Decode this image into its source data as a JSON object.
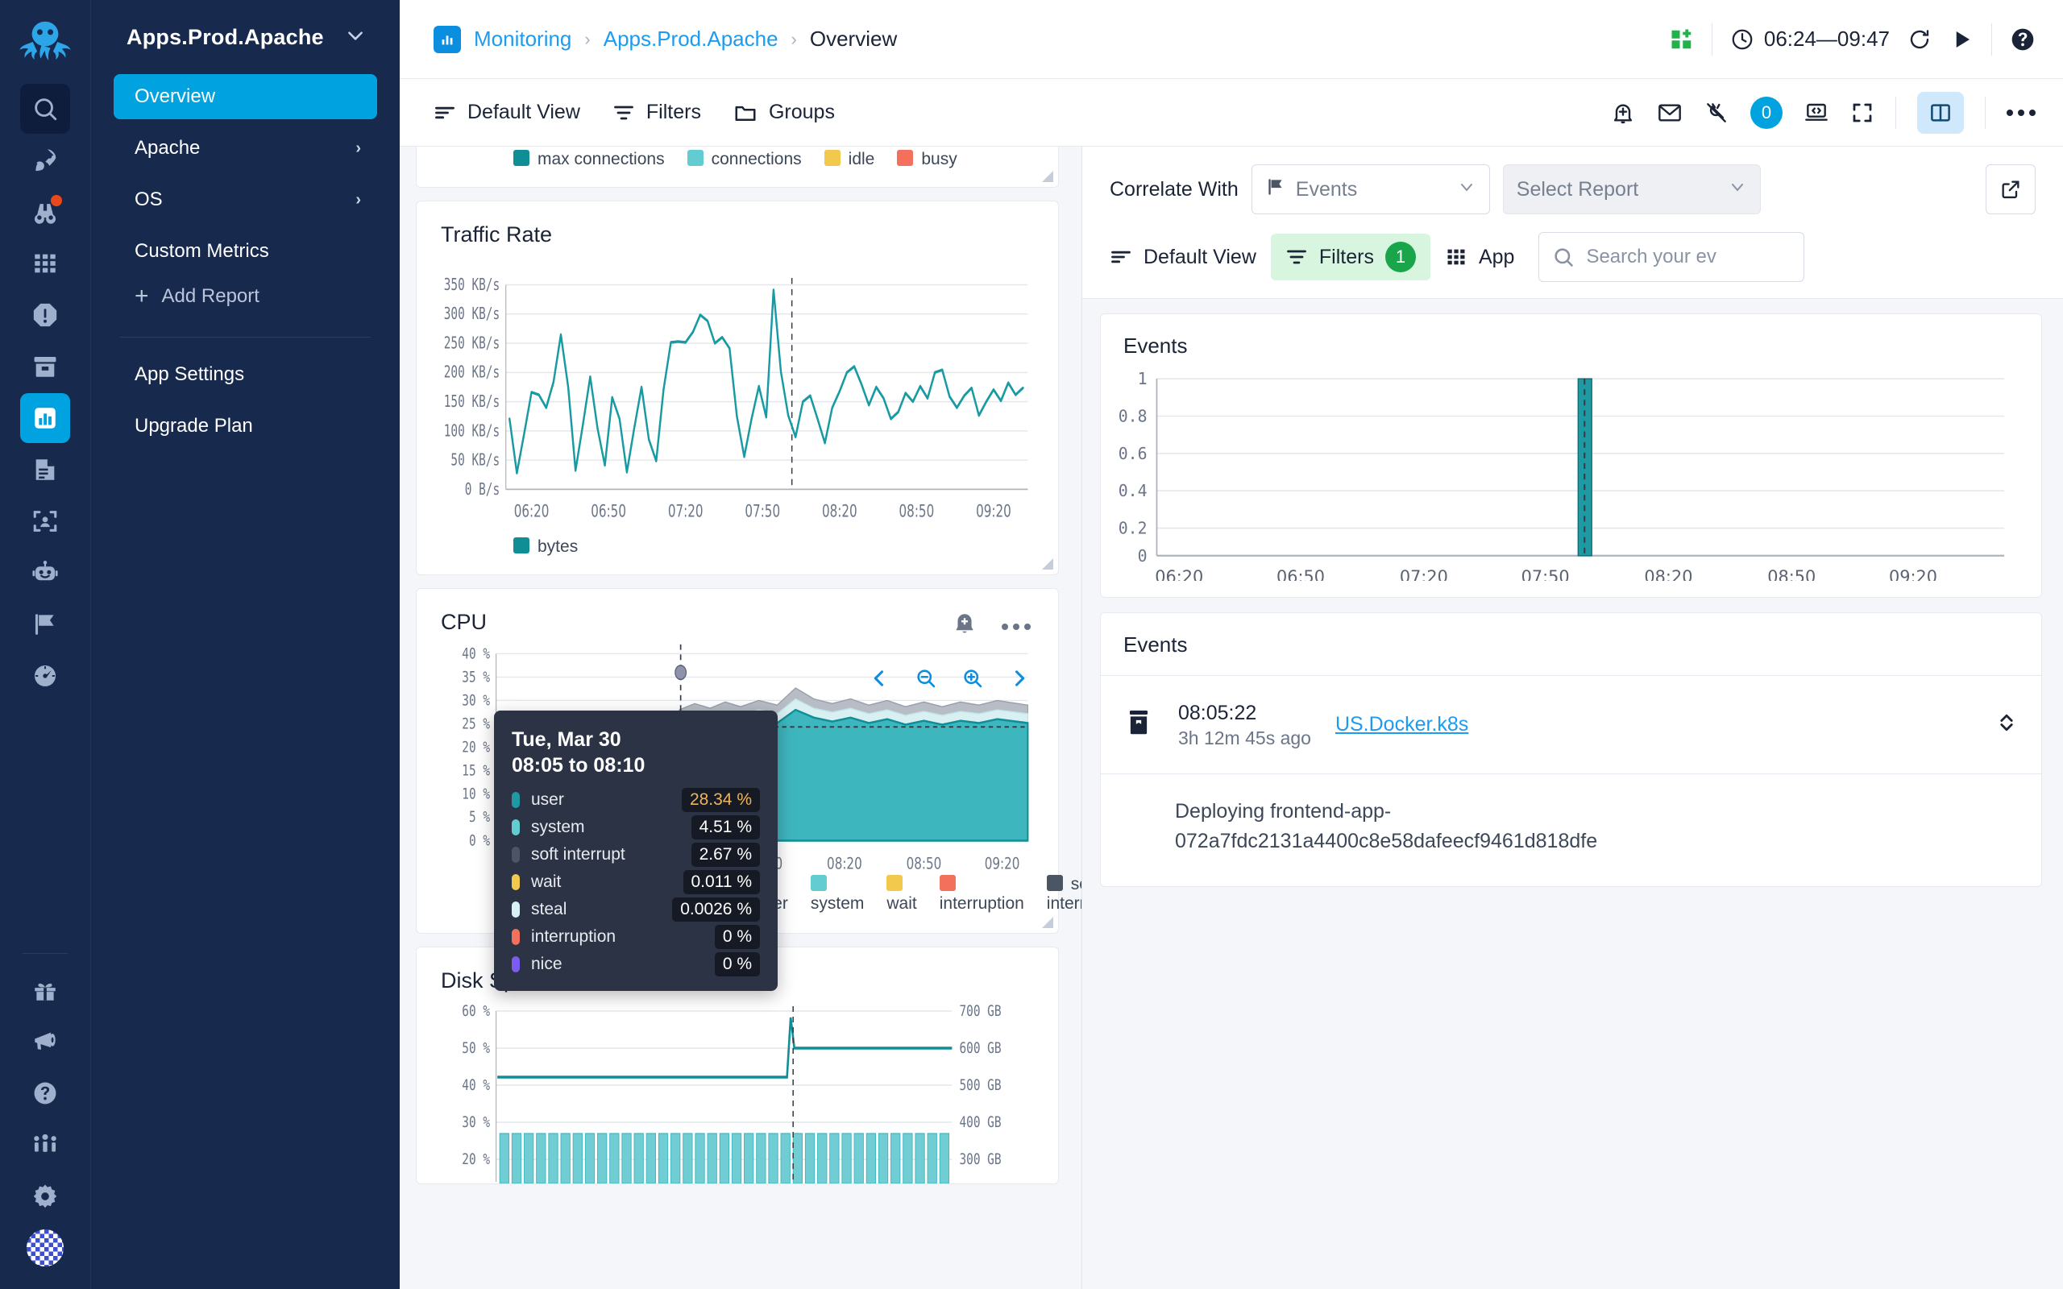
{
  "rail": {
    "logo_icon": "octopus-logo",
    "items": [
      {
        "name": "search-icon",
        "style": "dark"
      },
      {
        "name": "rocket-icon",
        "style": "plain"
      },
      {
        "name": "binoculars-icon",
        "style": "plain",
        "dot": true
      },
      {
        "name": "grid-icon",
        "style": "plain"
      },
      {
        "name": "alert-octagon-icon",
        "style": "plain"
      },
      {
        "name": "archive-icon",
        "style": "plain"
      },
      {
        "name": "bar-chart-icon",
        "style": "active"
      },
      {
        "name": "document-icon",
        "style": "plain"
      },
      {
        "name": "user-scan-icon",
        "style": "plain"
      },
      {
        "name": "robot-icon",
        "style": "plain"
      },
      {
        "name": "flag-icon",
        "style": "plain"
      },
      {
        "name": "gauge-icon",
        "style": "plain"
      }
    ],
    "bottom_items": [
      {
        "name": "gift-icon"
      },
      {
        "name": "megaphone-icon"
      },
      {
        "name": "help-circle-icon"
      },
      {
        "name": "community-icon"
      },
      {
        "name": "gear-icon"
      }
    ],
    "avatar": "user-avatar"
  },
  "sidebar": {
    "title": "Apps.Prod.Apache",
    "chevron": "⌄",
    "items": [
      {
        "label": "Overview",
        "selected": true,
        "arrow": ""
      },
      {
        "label": "Apache",
        "selected": false,
        "arrow": "›"
      },
      {
        "label": "OS",
        "selected": false,
        "arrow": "›"
      },
      {
        "label": "Custom Metrics",
        "selected": false,
        "arrow": ""
      }
    ],
    "add_report": "Add Report",
    "plus": "+",
    "footer_items": [
      {
        "label": "App Settings"
      },
      {
        "label": "Upgrade Plan"
      }
    ]
  },
  "topbar": {
    "breadcrumb": [
      {
        "label": "Monitoring",
        "link": true
      },
      {
        "label": "Apps.Prod.Apache",
        "link": true
      },
      {
        "label": "Overview",
        "link": false
      }
    ],
    "separator": "›",
    "time_range": "06:24—09:47",
    "icons": {
      "add_widget": "add-widget-icon",
      "clock": "clock-icon",
      "refresh": "refresh-icon",
      "play": "play-icon",
      "help": "help-icon"
    }
  },
  "toolbar": {
    "left": [
      {
        "label": "Default View",
        "icon": "view-lines-icon"
      },
      {
        "label": "Filters",
        "icon": "filter-icon"
      },
      {
        "label": "Groups",
        "icon": "folder-icon"
      }
    ],
    "right_icons": [
      {
        "name": "bell-plus-icon"
      },
      {
        "name": "mail-icon"
      },
      {
        "name": "plug-off-icon"
      },
      {
        "name": "laptop-code-icon"
      },
      {
        "name": "fullscreen-icon"
      },
      {
        "name": "split-panel-icon"
      },
      {
        "name": "more-icon"
      }
    ],
    "plug_badge": "0"
  },
  "panels": {
    "connections_legend": [
      {
        "label": "max connections",
        "color": "#0f8e96"
      },
      {
        "label": "connections",
        "color": "#63ccd2"
      },
      {
        "label": "idle",
        "color": "#f2c94c"
      },
      {
        "label": "busy",
        "color": "#f2705c"
      }
    ],
    "traffic": {
      "title": "Traffic Rate",
      "legend": [
        {
          "label": "bytes",
          "color": "#0f8e96"
        }
      ]
    },
    "cpu": {
      "title": "CPU",
      "actions": [
        "bell-plus-icon",
        "more-icon"
      ],
      "legend": [
        {
          "label": "user",
          "color": "#0f8e96"
        },
        {
          "label": "system",
          "color": "#63ccd2"
        },
        {
          "label": "wait",
          "color": "#f2c94c"
        },
        {
          "label": "interruption",
          "color": "#f2705c"
        },
        {
          "label": "soft interrupt",
          "color": "#4b5563"
        },
        {
          "label": "nice",
          "color": "#7c5cf0"
        },
        {
          "label": "steal",
          "color": "#d6f2f4"
        }
      ],
      "zoom_controls": [
        "prev-icon",
        "zoom-out-icon",
        "zoom-in-icon",
        "next-icon"
      ],
      "tooltip": {
        "date": "Tue, Mar 30",
        "range": "08:05 to 08:10",
        "rows": [
          {
            "label": "user",
            "value": "28.34 %",
            "color": "#1f9aa3",
            "highlight": true
          },
          {
            "label": "system",
            "value": "4.51 %",
            "color": "#63ccd2",
            "highlight": false
          },
          {
            "label": "soft interrupt",
            "value": "2.67 %",
            "color": "#4b5563",
            "highlight": false
          },
          {
            "label": "wait",
            "value": "0.011 %",
            "color": "#f2c94c",
            "highlight": false
          },
          {
            "label": "steal",
            "value": "0.0026 %",
            "color": "#d6f2f4",
            "highlight": false
          },
          {
            "label": "interruption",
            "value": "0 %",
            "color": "#f2705c",
            "highlight": false
          },
          {
            "label": "nice",
            "value": "0 %",
            "color": "#7c5cf0",
            "highlight": false
          }
        ]
      }
    },
    "disk": {
      "title": "Disk Space Used"
    }
  },
  "correlate": {
    "label": "Correlate With",
    "source_value": "Events",
    "source_icon": "flag-icon",
    "report_placeholder": "Select Report",
    "open_external_icon": "external-link-icon",
    "chevron": "∨",
    "view_label": "Default View",
    "filters_label": "Filters",
    "filters_count": "1",
    "app_label": "App",
    "search_placeholder": "Search your ev"
  },
  "events_chart_card": {
    "title": "Events"
  },
  "events_list": {
    "title": "Events",
    "rows": [
      {
        "icon": "archive-icon",
        "time": "08:05:22",
        "ago": "3h 12m 45s ago",
        "source": "US.Docker.k8s",
        "sort_icon": "sort-updown-icon",
        "body_line1": "Deploying frontend-app-",
        "body_line2": "072a7fdc2131a4400c8e58dafeecf9461d818dfe"
      }
    ]
  },
  "chart_data": [
    {
      "type": "line",
      "title": "Traffic Rate",
      "ylabel": "",
      "xlabel": "",
      "ytick_labels": [
        "350 KB/s",
        "300 KB/s",
        "250 KB/s",
        "200 KB/s",
        "150 KB/s",
        "100 KB/s",
        "50 KB/s",
        "0 B/s"
      ],
      "yticks": [
        350,
        300,
        250,
        200,
        150,
        100,
        50,
        0
      ],
      "ylim": [
        0,
        350
      ],
      "xtick_labels": [
        "06:20",
        "06:50",
        "07:20",
        "07:50",
        "08:20",
        "08:50",
        "09:20"
      ],
      "grid": true,
      "legend": [
        "bytes"
      ],
      "series": [
        {
          "name": "bytes",
          "color": "#0f8e96",
          "values": [
            120,
            28,
            95,
            165,
            160,
            140,
            185,
            265,
            175,
            32,
            110,
            192,
            105,
            40,
            158,
            120,
            30,
            105,
            175,
            85,
            48,
            170,
            252,
            254,
            253,
            270,
            298,
            290,
            250,
            262,
            240,
            125,
            55,
            120,
            180,
            120,
            355,
            210,
            125,
            90,
            145,
            160,
            120,
            80,
            140,
            168,
            200,
            215,
            180,
            145,
            175,
            155,
            120,
            130,
            165,
            150,
            175,
            155,
            200,
            205,
            160,
            145,
            165,
            180,
            130,
            150,
            170
          ]
        }
      ],
      "annotations": [
        {
          "type": "vline",
          "x": "~08:05",
          "style": "dashed"
        }
      ]
    },
    {
      "type": "area",
      "title": "CPU",
      "ytick_labels": [
        "40 %",
        "35 %",
        "30 %",
        "25 %",
        "20 %",
        "15 %",
        "10 %",
        "5 %",
        "0 %"
      ],
      "yticks": [
        40,
        35,
        30,
        25,
        20,
        15,
        10,
        5,
        0
      ],
      "ylim": [
        0,
        40
      ],
      "xtick_labels": [
        "06:20",
        "06:50",
        "07:20",
        "07:50",
        "08:20",
        "08:50",
        "09:20"
      ],
      "grid": true,
      "legend": [
        "user",
        "system",
        "wait",
        "interruption",
        "soft interrupt",
        "nice",
        "steal"
      ],
      "series": [
        {
          "name": "user",
          "color": "#2aa7ae",
          "values": [
            9,
            9,
            8.5,
            9,
            9.5,
            9,
            8.8,
            9.2,
            9,
            8.7,
            9.4,
            9,
            8.6,
            9.1,
            9,
            8.8,
            9.3,
            9,
            28.3,
            27.5,
            28.2,
            27.8,
            28.6,
            27.2,
            28.4,
            27.6,
            28.1,
            27.4,
            28.3,
            27.9,
            28.5,
            27.3,
            28.2,
            27.7,
            28.4
          ]
        },
        {
          "name": "system",
          "color": "#9fdce0",
          "values": [
            2.2,
            2.1,
            2.3,
            2.2,
            2.4,
            2.1,
            2.3,
            2.2,
            2.1,
            2.3,
            2.2,
            2.4,
            2.1,
            2.3,
            2.2,
            2.1,
            2.4,
            2.2,
            4.5,
            4.4,
            4.6,
            4.3,
            4.7,
            4.4,
            4.5,
            4.2,
            4.6,
            4.4,
            4.5,
            4.3,
            4.7,
            4.4,
            4.5,
            4.3,
            4.6
          ]
        },
        {
          "name": "soft interrupt",
          "color": "#a9aeb8",
          "values": [
            1.1,
            1.0,
            1.2,
            1.1,
            1.0,
            1.2,
            1.1,
            1.0,
            1.1,
            1.2,
            1.0,
            1.1,
            1.2,
            1.0,
            1.1,
            1.2,
            1.0,
            1.1,
            2.7,
            2.6,
            2.8,
            2.5,
            2.9,
            2.6,
            2.7,
            2.5,
            2.8,
            2.6,
            2.7,
            2.5,
            2.9,
            2.6,
            2.7,
            2.6,
            2.8
          ]
        }
      ],
      "annotations": [
        {
          "type": "vline",
          "x": "08:05",
          "style": "dashed"
        },
        {
          "type": "hline",
          "y": 25,
          "style": "dashed"
        }
      ]
    },
    {
      "type": "bar",
      "title": "Disk Space Used",
      "ytick_labels": [
        "60 %",
        "50 %",
        "40 %",
        "30 %",
        "20 %"
      ],
      "yticks": [
        60,
        50,
        40,
        30,
        20
      ],
      "ylim": [
        0,
        60
      ],
      "y2tick_labels": [
        "700 GB",
        "600 GB",
        "500 GB",
        "400 GB",
        "300 GB"
      ],
      "y2ticks": [
        700,
        600,
        500,
        400,
        300
      ],
      "grid": true,
      "series": [
        {
          "name": "used percent line",
          "color": "#0f8e96",
          "type": "line",
          "values": [
            42,
            42,
            42,
            42,
            42,
            42,
            42,
            42,
            42,
            42,
            42,
            42,
            42,
            42,
            42,
            42,
            42,
            42,
            42,
            42,
            42,
            42,
            58,
            52,
            52,
            52,
            52,
            52,
            52,
            52,
            52,
            52,
            52,
            52,
            52,
            52,
            52,
            52
          ]
        },
        {
          "name": "used bytes bars",
          "color": "#63ccd2",
          "type": "bar",
          "values": [
            28.5,
            28.5,
            28.5,
            28.5,
            28.5,
            28.5,
            28.5,
            28.5,
            28.5,
            28.5,
            28.5,
            28.5,
            28.5,
            28.5,
            28.5,
            28.5,
            28.5,
            28.5,
            28.5,
            28.5,
            28.5,
            28.5,
            28.5,
            28.5,
            28.5,
            28.5,
            28.5,
            28.5,
            28.5,
            28.5,
            28.5,
            28.5,
            28.5,
            28.5,
            28.5,
            28.5,
            28.5,
            28.5
          ]
        }
      ]
    },
    {
      "type": "bar",
      "title": "Events",
      "yticks": [
        0,
        0.2,
        0.4,
        0.6,
        0.8,
        1
      ],
      "ytick_labels": [
        "0",
        "0.2",
        "0.4",
        "0.6",
        "0.8",
        "1"
      ],
      "ylim": [
        0,
        1
      ],
      "xtick_labels": [
        "06:20",
        "06:50",
        "07:20",
        "07:50",
        "08:20",
        "08:50",
        "09:20"
      ],
      "grid": true,
      "categories": [
        "08:05"
      ],
      "values": [
        1
      ],
      "bar_color": "#1f9aa3"
    }
  ]
}
